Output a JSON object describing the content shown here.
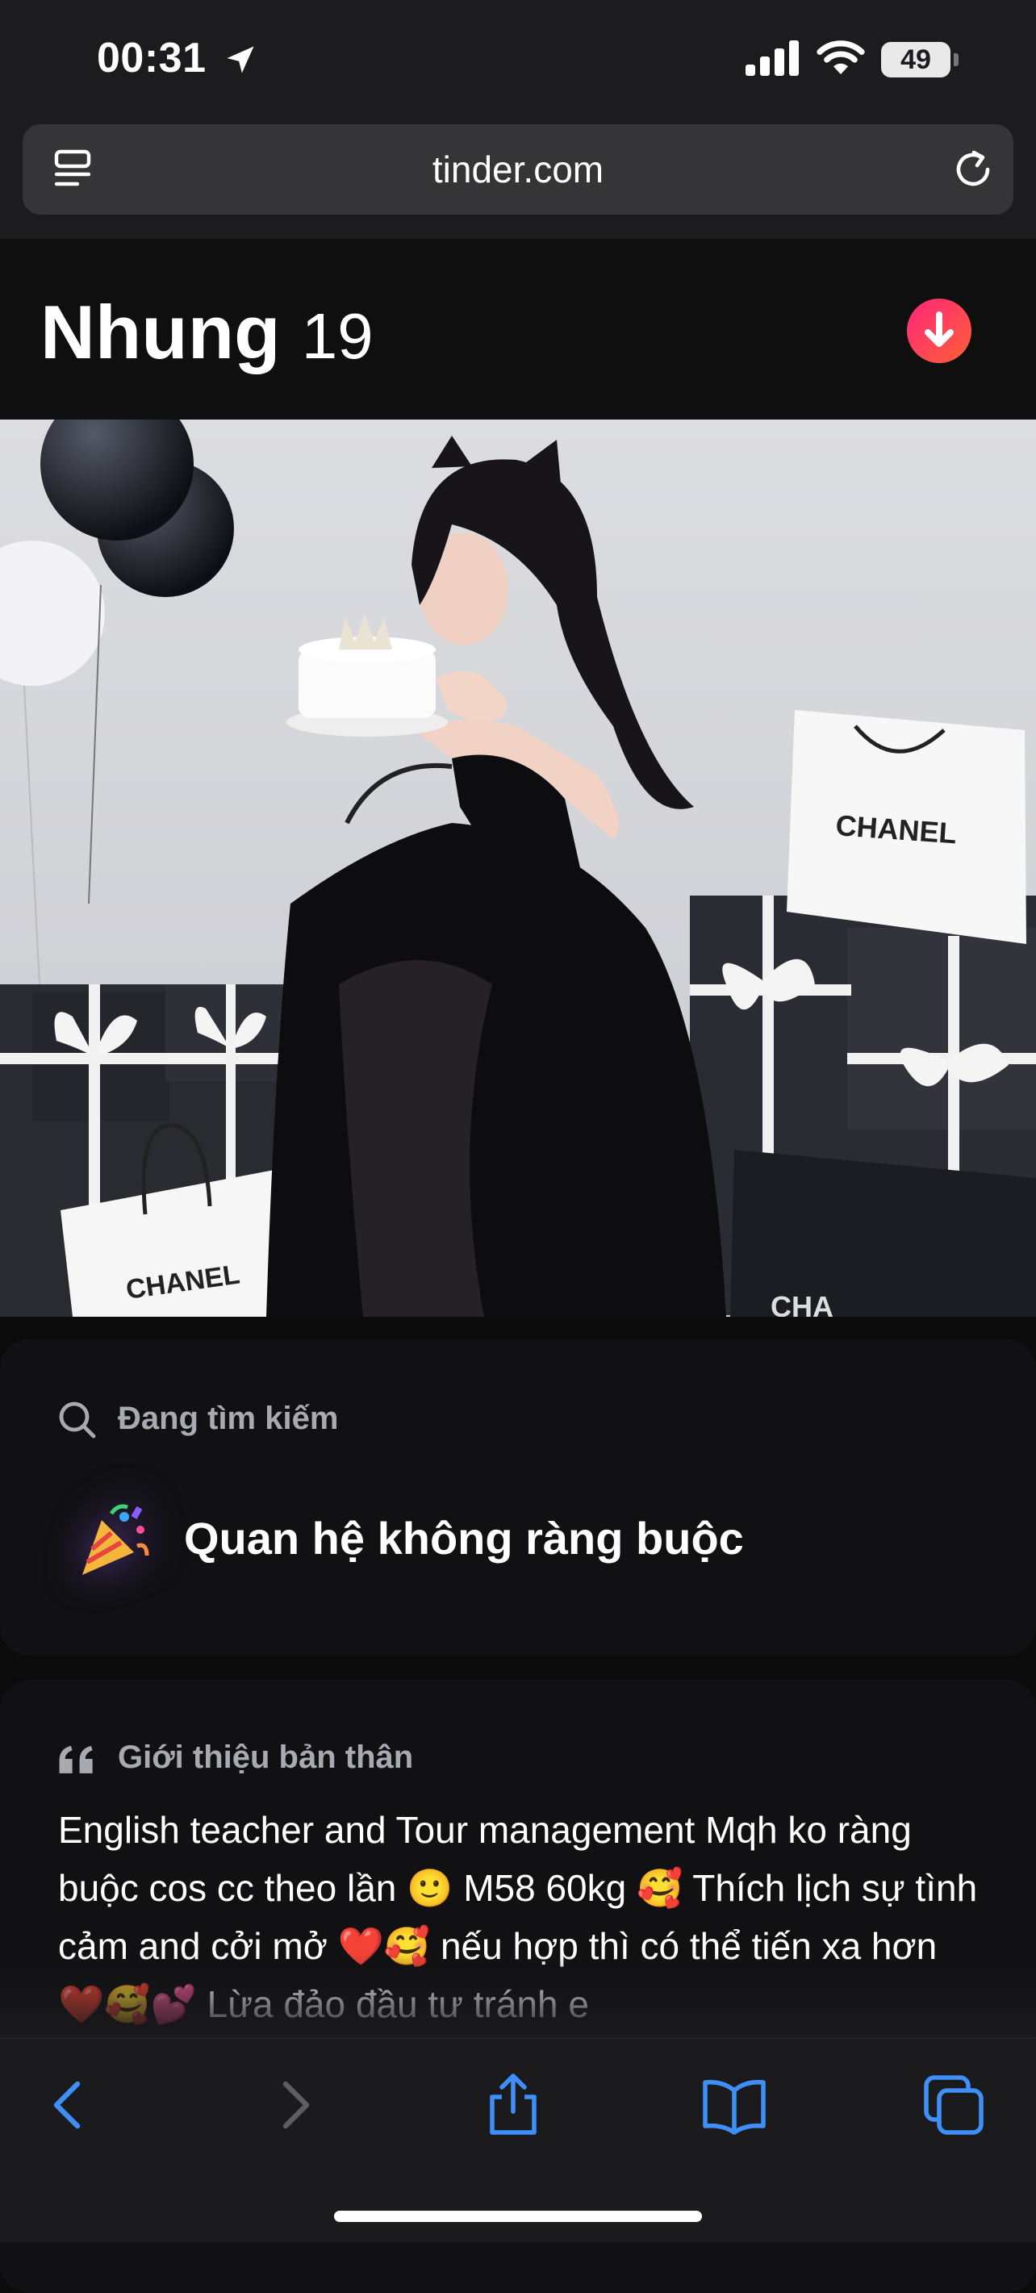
{
  "status_bar": {
    "time": "00:31",
    "battery": "49"
  },
  "browser": {
    "url": "tinder.com"
  },
  "profile": {
    "name": "Nhung",
    "age": "19"
  },
  "photo": {
    "bag_brand_1": "CHANEL",
    "bag_brand_2": "CHANEL",
    "bag_brand_3": "CHA"
  },
  "looking_for": {
    "label": "Đang tìm kiếm",
    "value": "Quan hệ không ràng buộc",
    "emoji": "🎉"
  },
  "bio": {
    "label": "Giới thiệu bản thân",
    "text": "English teacher and Tour management Mqh ko ràng buộc cos cc theo lần 🙂 M58 60kg 🥰 Thích lịch sự tình cảm and cởi mở ❤️🥰 nếu hợp thì có thể tiến xa hơn ❤️🥰💕 Lừa đảo đầu tư tránh e"
  },
  "colors": {
    "accent_start": "#fd267a",
    "accent_end": "#ff6036",
    "toolbar_blue": "#3e8ff7",
    "toolbar_disabled": "#5d5d62"
  },
  "toolbar": {
    "icons": [
      "back-icon",
      "forward-icon",
      "share-icon",
      "bookmarks-icon",
      "tabs-icon"
    ]
  }
}
